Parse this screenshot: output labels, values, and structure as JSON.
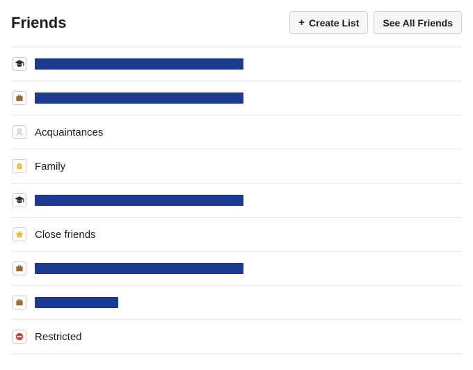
{
  "header": {
    "title": "Friends",
    "create_label": "Create List",
    "see_all_label": "See All Friends"
  },
  "colors": {
    "redaction": "#1b3b91"
  },
  "lists": [
    {
      "icon": "graduation-cap",
      "redacted": true,
      "redact_width": 300,
      "label": ""
    },
    {
      "icon": "briefcase",
      "redacted": true,
      "redact_width": 300,
      "label": ""
    },
    {
      "icon": "person-outline",
      "redacted": false,
      "label": "Acquaintances"
    },
    {
      "icon": "home-star",
      "redacted": false,
      "label": "Family"
    },
    {
      "icon": "graduation-cap",
      "redacted": true,
      "redact_width": 300,
      "label": ""
    },
    {
      "icon": "star",
      "redacted": false,
      "label": "Close friends"
    },
    {
      "icon": "briefcase",
      "redacted": true,
      "redact_width": 300,
      "label": ""
    },
    {
      "icon": "briefcase",
      "redacted": true,
      "redact_width": 120,
      "label": ""
    },
    {
      "icon": "restricted",
      "redacted": false,
      "label": "Restricted"
    }
  ]
}
